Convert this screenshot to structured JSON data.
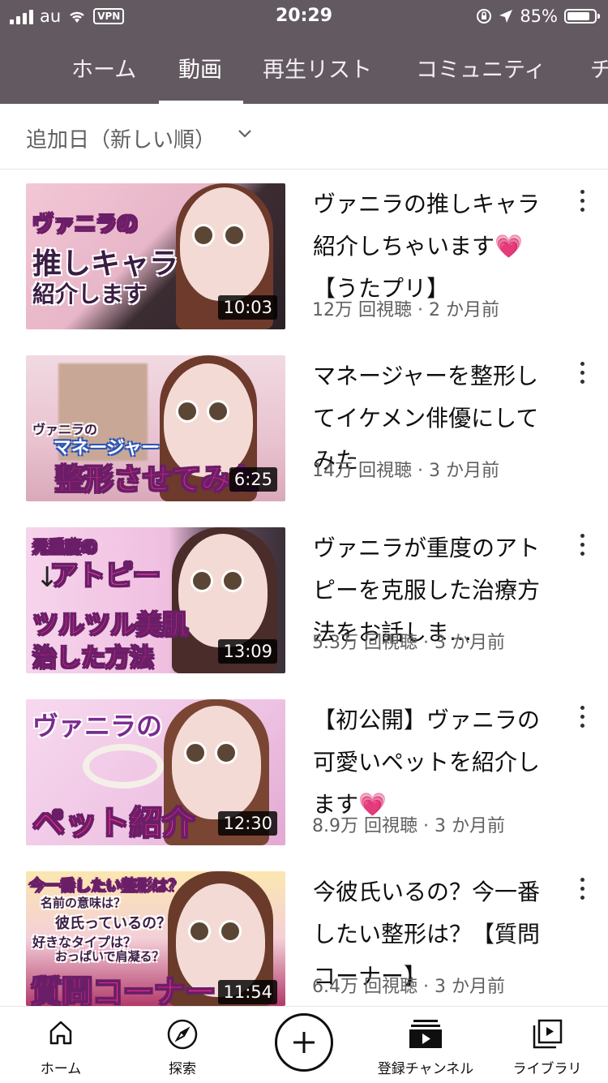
{
  "status_bar": {
    "carrier": "au",
    "vpn": "VPN",
    "time": "20:29",
    "battery": "85%",
    "battery_level": 0.85
  },
  "tabs": [
    {
      "label": "ホーム"
    },
    {
      "label": "動画"
    },
    {
      "label": "再生リスト"
    },
    {
      "label": "コミュニティ"
    },
    {
      "label": "チ"
    }
  ],
  "sort": {
    "label": "追加日（新しい順）"
  },
  "videos": [
    {
      "title": "ヴァニラの推しキャラ紹介しちゃいます💗【うたプリ】",
      "meta": "12万 回視聴 · 2 か月前",
      "duration": "10:03",
      "thumb_text": [
        "ヴァニラの",
        "推しキャラ",
        "紹介します"
      ]
    },
    {
      "title": "マネージャーを整形してイケメン俳優にしてみた",
      "meta": "14万 回視聴 · 3 か月前",
      "duration": "6:25",
      "thumb_text": [
        "ヴァニラの",
        "マネージャー",
        "整形させてみた"
      ]
    },
    {
      "title": "ヴァニラが重度のアトピーを克服した治療方法をお話しま…",
      "meta": "5.3万 回視聴 · 3 か月前",
      "duration": "13:09",
      "thumb_text": [
        "元重度の",
        "アトピー",
        "ツルツル美肌",
        "治した方法"
      ]
    },
    {
      "title": "【初公開】ヴァニラの可愛いペットを紹介します💗",
      "meta": "8.9万 回視聴 · 3 か月前",
      "duration": "12:30",
      "thumb_text": [
        "ヴァニラの",
        "ペット紹介"
      ]
    },
    {
      "title": "今彼氏いるの？今一番したい整形は？【質問コーナー】",
      "meta": "6.4万 回視聴 · 3 か月前",
      "duration": "11:54",
      "thumb_text": [
        "今一番したい整形は？",
        "名前の意味は？",
        "彼氏っているの？",
        "好きなタイプは？",
        "おっぱいで肩凝る？",
        "質問コーナー"
      ]
    }
  ],
  "bottom_nav": [
    {
      "label": "ホーム",
      "icon": "home-icon"
    },
    {
      "label": "探索",
      "icon": "explore-icon"
    },
    {
      "label": "",
      "icon": "create-plus-icon"
    },
    {
      "label": "登録チャンネル",
      "icon": "subscriptions-icon"
    },
    {
      "label": "ライブラリ",
      "icon": "library-icon"
    }
  ],
  "colors": {
    "header": "#635a61",
    "text": "#0f0f0f",
    "meta": "#606060"
  }
}
